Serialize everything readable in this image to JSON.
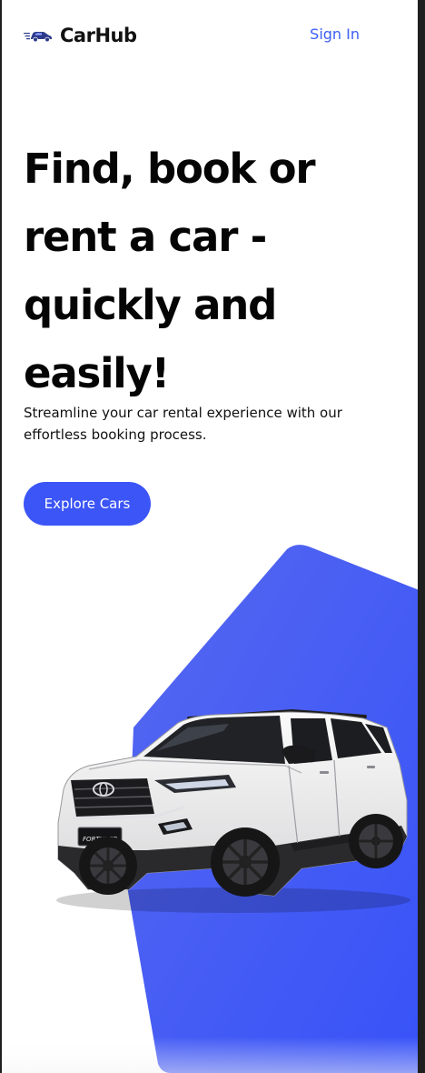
{
  "navbar": {
    "brand_name": "CarHub",
    "sign_in_label": "Sign In",
    "logo_icon": "speeding-car-icon"
  },
  "hero": {
    "title": "Find, book or rent a car - quickly and easily!",
    "subtitle": "Streamline your car rental experience with our effortless booking process.",
    "cta_label": "Explore Cars",
    "image": "white-suv-car-illustration",
    "badge_text": "FORTUNER"
  },
  "colors": {
    "accent": "#3b55f6",
    "link": "#3b5ff5",
    "text": "#050505",
    "background": "#ffffff"
  }
}
